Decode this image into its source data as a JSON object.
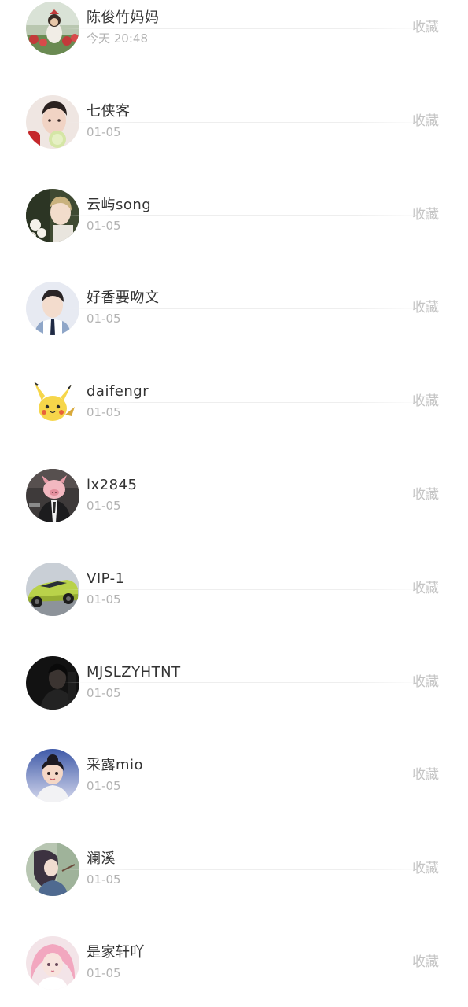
{
  "items": [
    {
      "name": " 陈俊竹妈妈",
      "date": "今天 20:48",
      "action": "收藏",
      "avatar_icon": "girl-with-flowers-avatar-icon"
    },
    {
      "name": "七侠客",
      "date": "01-05",
      "action": "收藏",
      "avatar_icon": "boy-with-balloon-avatar-icon"
    },
    {
      "name": "云屿song",
      "date": "01-05",
      "action": "收藏",
      "avatar_icon": "man-with-flowers-avatar-icon"
    },
    {
      "name": "好香要吻文",
      "date": "01-05",
      "action": "收藏",
      "avatar_icon": "boy-in-uniform-avatar-icon"
    },
    {
      "name": "daifengr",
      "date": "01-05",
      "action": "收藏",
      "avatar_icon": "pikachu-avatar-icon"
    },
    {
      "name": "lx2845",
      "date": "01-05",
      "action": "收藏",
      "avatar_icon": "pig-in-suit-avatar-icon"
    },
    {
      "name": "VIP-1",
      "date": "01-05",
      "action": "收藏",
      "avatar_icon": "green-sports-car-avatar-icon"
    },
    {
      "name": "MJSLZYHTNT",
      "date": "01-05",
      "action": "收藏",
      "avatar_icon": "dark-portrait-avatar-icon"
    },
    {
      "name": "采露mio",
      "date": "01-05",
      "action": "收藏",
      "avatar_icon": "cartoon-girl-avatar-icon"
    },
    {
      "name": "澜溪",
      "date": "01-05",
      "action": "收藏",
      "avatar_icon": "anime-girl-avatar-icon"
    },
    {
      "name": "是家轩吖",
      "date": "01-05",
      "action": "收藏",
      "avatar_icon": "pink-hair-girl-avatar-icon"
    }
  ]
}
